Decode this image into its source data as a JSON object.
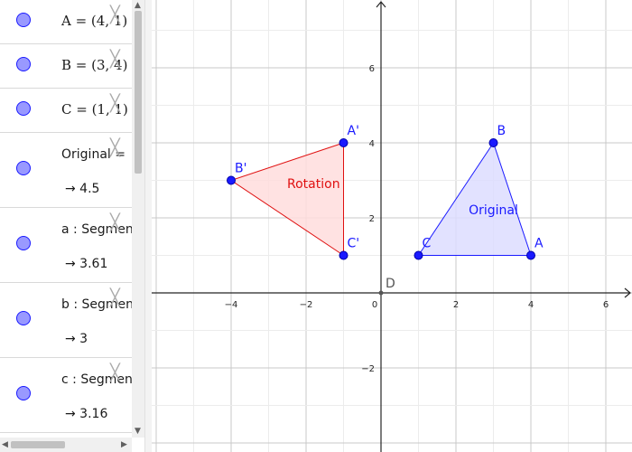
{
  "algebra": {
    "rows": [
      {
        "def": "A = (4, 1)",
        "val": ""
      },
      {
        "def": "B = (3, 4)",
        "val": ""
      },
      {
        "def": "C = (1, 1)",
        "val": ""
      },
      {
        "def": "Original =",
        "val": "→  4.5"
      },
      {
        "def": "a : Segment",
        "val": "→  3.61"
      },
      {
        "def": "b : Segment",
        "val": "→  3"
      },
      {
        "def": "c : Segment",
        "val": "→  3.16"
      }
    ],
    "delete_glyph": "╳"
  },
  "graph": {
    "xTicks": [
      -4,
      -2,
      0,
      2,
      4,
      6
    ],
    "yTicks": [
      -2,
      2,
      4,
      6
    ],
    "points": [
      {
        "label": "A",
        "x": 4,
        "y": 1,
        "color": "#1a1aff"
      },
      {
        "label": "B",
        "x": 3,
        "y": 4,
        "color": "#1a1aff"
      },
      {
        "label": "C",
        "x": 1,
        "y": 1,
        "color": "#1a1aff"
      },
      {
        "label": "A'",
        "x": -1,
        "y": 4,
        "color": "#1a1aff"
      },
      {
        "label": "B'",
        "x": -4,
        "y": 3,
        "color": "#1a1aff"
      },
      {
        "label": "C'",
        "x": -1,
        "y": 1,
        "color": "#1a1aff"
      },
      {
        "label": "D",
        "x": 0,
        "y": 0,
        "color": "#555555"
      }
    ],
    "polygons": [
      {
        "label": "Original",
        "vertices": [
          [
            4,
            1
          ],
          [
            3,
            4
          ],
          [
            1,
            1
          ]
        ],
        "stroke": "#1a1aff",
        "fill": "#ddddff",
        "labelPos": [
          3,
          2.1
        ]
      },
      {
        "label": "Rotation",
        "vertices": [
          [
            -1,
            4
          ],
          [
            -4,
            3
          ],
          [
            -1,
            1
          ]
        ],
        "stroke": "#e01010",
        "fill": "#ffdddd",
        "labelPos": [
          -1.8,
          2.8
        ]
      }
    ]
  }
}
